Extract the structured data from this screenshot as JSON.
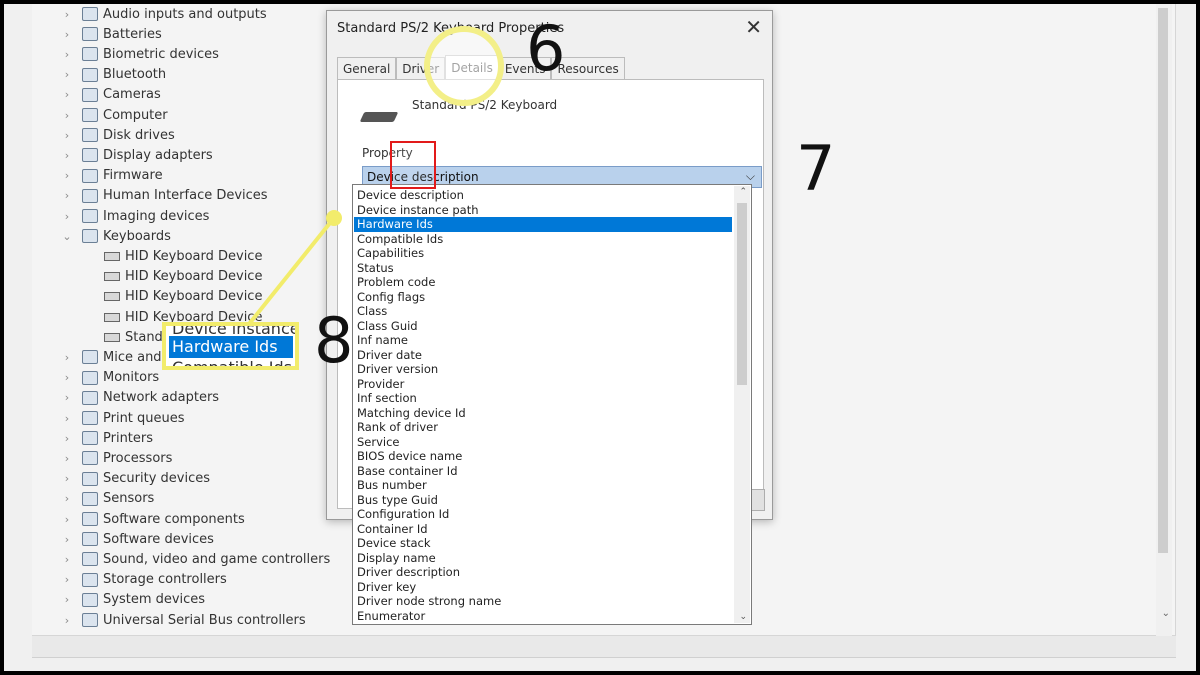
{
  "device_tree": {
    "items": [
      {
        "label": "Audio inputs and outputs",
        "expanded": false
      },
      {
        "label": "Batteries",
        "expanded": false
      },
      {
        "label": "Biometric devices",
        "expanded": false
      },
      {
        "label": "Bluetooth",
        "expanded": false
      },
      {
        "label": "Cameras",
        "expanded": false
      },
      {
        "label": "Computer",
        "expanded": false
      },
      {
        "label": "Disk drives",
        "expanded": false
      },
      {
        "label": "Display adapters",
        "expanded": false
      },
      {
        "label": "Firmware",
        "expanded": false
      },
      {
        "label": "Human Interface Devices",
        "expanded": false
      },
      {
        "label": "Imaging devices",
        "expanded": false
      },
      {
        "label": "Keyboards",
        "expanded": true
      },
      {
        "label": "HID Keyboard Device",
        "child": true
      },
      {
        "label": "HID Keyboard Device",
        "child": true
      },
      {
        "label": "HID Keyboard Device",
        "child": true
      },
      {
        "label": "HID Keyboard Device",
        "child": true
      },
      {
        "label": "Standa",
        "child": true
      },
      {
        "label": "Mice and",
        "expanded": false
      },
      {
        "label": "Monitors",
        "expanded": false
      },
      {
        "label": "Network adapters",
        "expanded": false
      },
      {
        "label": "Print queues",
        "expanded": false
      },
      {
        "label": "Printers",
        "expanded": false
      },
      {
        "label": "Processors",
        "expanded": false
      },
      {
        "label": "Security devices",
        "expanded": false
      },
      {
        "label": "Sensors",
        "expanded": false
      },
      {
        "label": "Software components",
        "expanded": false
      },
      {
        "label": "Software devices",
        "expanded": false
      },
      {
        "label": "Sound, video and game controllers",
        "expanded": false
      },
      {
        "label": "Storage controllers",
        "expanded": false
      },
      {
        "label": "System devices",
        "expanded": false
      },
      {
        "label": "Universal Serial Bus controllers",
        "expanded": false
      }
    ]
  },
  "dialog": {
    "title": "Standard PS/2 Keyboard Properties",
    "close_glyph": "✕",
    "tabs": [
      {
        "label": "General"
      },
      {
        "label": "Driver"
      },
      {
        "label": "Details",
        "active": true
      },
      {
        "label": "Events"
      },
      {
        "label": "Resources"
      }
    ],
    "device_name": "Standard PS/2 Keyboard",
    "property_label": "Property",
    "property_value": "Device description",
    "dropdown_arrow": "⌵",
    "options": [
      "Device description",
      "Device instance path",
      "Hardware Ids",
      "Compatible Ids",
      "Capabilities",
      "Status",
      "Problem code",
      "Config flags",
      "Class",
      "Class Guid",
      "Inf name",
      "Driver date",
      "Driver version",
      "Provider",
      "Inf section",
      "Matching device Id",
      "Rank of driver",
      "Service",
      "BIOS device name",
      "Base container Id",
      "Bus number",
      "Bus type Guid",
      "Configuration Id",
      "Container Id",
      "Device stack",
      "Display name",
      "Driver description",
      "Driver key",
      "Driver node strong name",
      "Enumerator"
    ],
    "selected_option": "Hardware Ids"
  },
  "annotations": {
    "step6": "6",
    "step7": "7",
    "step8": "8",
    "zoom_top": "Device instance",
    "zoom_selected": "Hardware Ids",
    "zoom_bottom": "Compatible Ids",
    "highlight_color": "#f2ec6b",
    "box_color": "#e21a1a"
  },
  "colors": {
    "selection": "#0078d7",
    "dropdown_bg": "#b9d1ec"
  }
}
